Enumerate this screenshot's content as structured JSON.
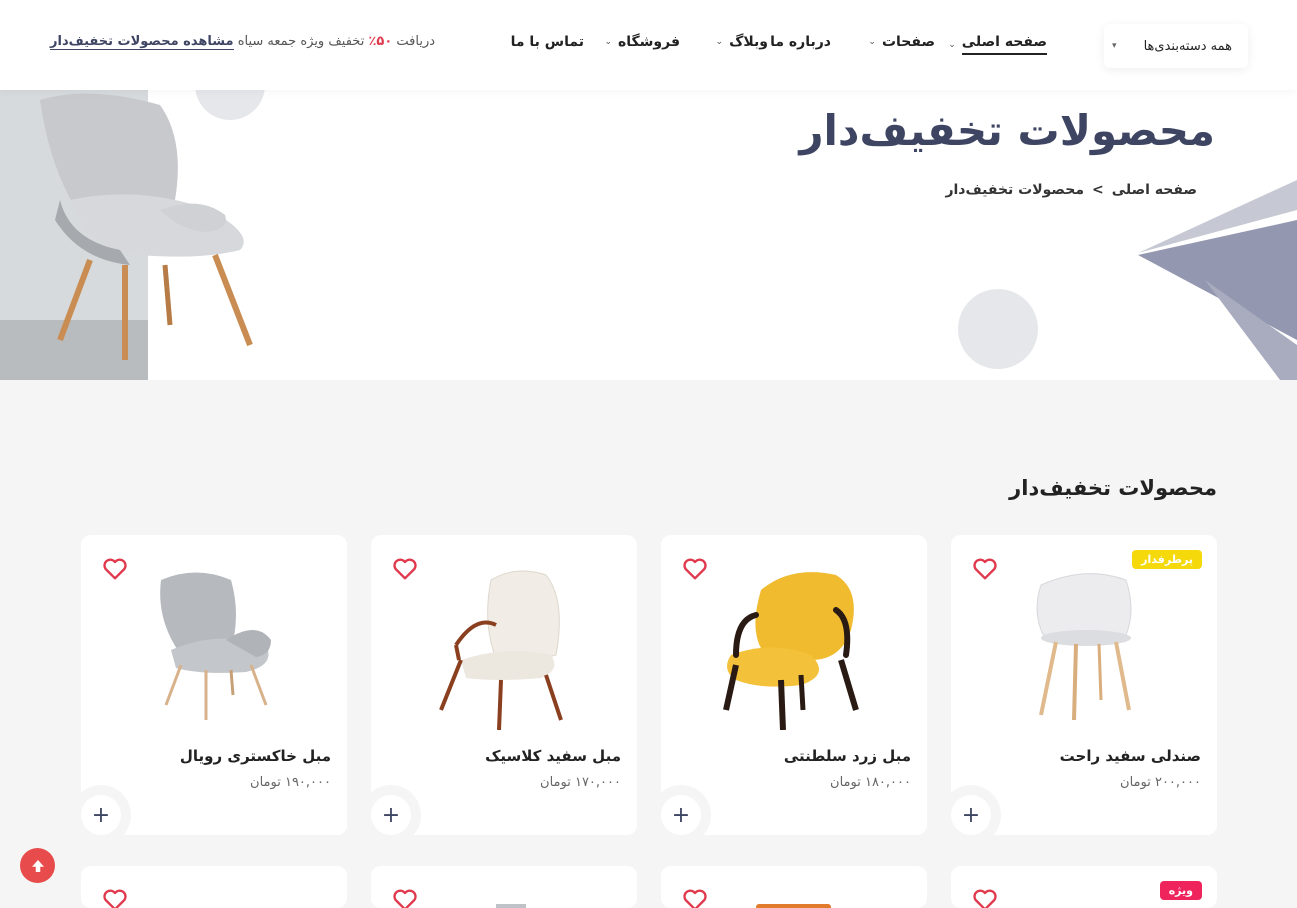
{
  "header": {
    "categories_label": "همه دسته‌بندی‌ها",
    "nav": [
      {
        "label": "صفحه اصلی",
        "dropdown": true,
        "active": true
      },
      {
        "label": "صفحات",
        "dropdown": true,
        "active": false
      },
      {
        "label": "درباره ما",
        "dropdown": false,
        "active": false
      },
      {
        "label": "وبلاگ",
        "dropdown": true,
        "active": false
      },
      {
        "label": "فروشگاه",
        "dropdown": true,
        "active": false
      },
      {
        "label": "تماس با ما",
        "dropdown": false,
        "active": false
      }
    ],
    "promo_prefix": "دریافت",
    "promo_percent": "۵۰٪",
    "promo_middle": "تخفیف ویژه جمعه سیاه",
    "promo_link": "مشاهده محصولات تخفیف‌دار"
  },
  "hero": {
    "title": "محصولات تخفیف‌دار",
    "breadcrumb": [
      "صفحه اصلی",
      ">",
      "محصولات تخفیف‌دار"
    ]
  },
  "section": {
    "title": "محصولات تخفیف‌دار"
  },
  "products": [
    {
      "name": "صندلی سفید راحت",
      "price": "۲۰۰,۰۰۰ تومان",
      "badge": "پرطرفدار",
      "badge_color": "#f5d90a",
      "image": "white-shell-chair"
    },
    {
      "name": "مبل زرد سلطنتی",
      "price": "۱۸۰,۰۰۰ تومان",
      "badge": "",
      "image": "yellow-armchair"
    },
    {
      "name": "مبل سفید کلاسیک",
      "price": "۱۷۰,۰۰۰ تومان",
      "badge": "",
      "image": "white-wingback-chair"
    },
    {
      "name": "مبل خاکستری رویال",
      "price": "۱۹۰,۰۰۰ تومان",
      "badge": "",
      "image": "gray-armchair"
    }
  ],
  "products_row2": [
    {
      "badge": "ویژه",
      "badge_color": "#f0245d"
    },
    {
      "badge": ""
    },
    {
      "badge": ""
    },
    {
      "badge": ""
    }
  ],
  "colors": {
    "accent": "#3e4562",
    "heart": "#e0394d",
    "scroll_top": "#e84b4b"
  }
}
